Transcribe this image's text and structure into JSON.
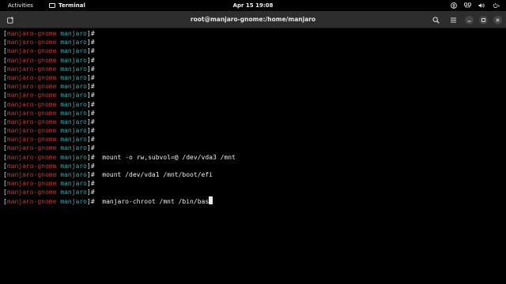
{
  "topbar": {
    "activities": "Activities",
    "app_name": "Terminal",
    "clock": "Apr 15  19:08",
    "tray_icons": [
      "accessibility-icon",
      "network-icon",
      "volume-icon",
      "power-icon"
    ]
  },
  "window": {
    "title": "root@manjaro-gnome:/home/manjaro",
    "buttons": [
      "new-tab-icon",
      "search-icon",
      "menu-icon",
      "minimize-icon",
      "maximize-icon",
      "close-icon"
    ]
  },
  "terminal": {
    "prompt": {
      "open_bracket": "[",
      "host": "manjaro-gnome",
      "space": " ",
      "dir": "manjaro",
      "close": "]#"
    },
    "lines": [
      {
        "cmd": ""
      },
      {
        "cmd": ""
      },
      {
        "cmd": ""
      },
      {
        "cmd": ""
      },
      {
        "cmd": ""
      },
      {
        "cmd": ""
      },
      {
        "cmd": ""
      },
      {
        "cmd": ""
      },
      {
        "cmd": ""
      },
      {
        "cmd": ""
      },
      {
        "cmd": ""
      },
      {
        "cmd": ""
      },
      {
        "cmd": ""
      },
      {
        "cmd": ""
      },
      {
        "cmd": "mount -o rw,subvol=@ /dev/vda3 /mnt"
      },
      {
        "cmd": ""
      },
      {
        "cmd": "mount /dev/vda1 /mnt/boot/efi"
      },
      {
        "cmd": ""
      },
      {
        "cmd": ""
      },
      {
        "cmd": "manjaro-chroot /mnt /bin/bas"
      }
    ],
    "cursor_line": 19
  },
  "colors": {
    "host": "#cc3333",
    "dir": "#3aa7a7",
    "background": "#000000",
    "headerbar": "#2d2d2d"
  }
}
